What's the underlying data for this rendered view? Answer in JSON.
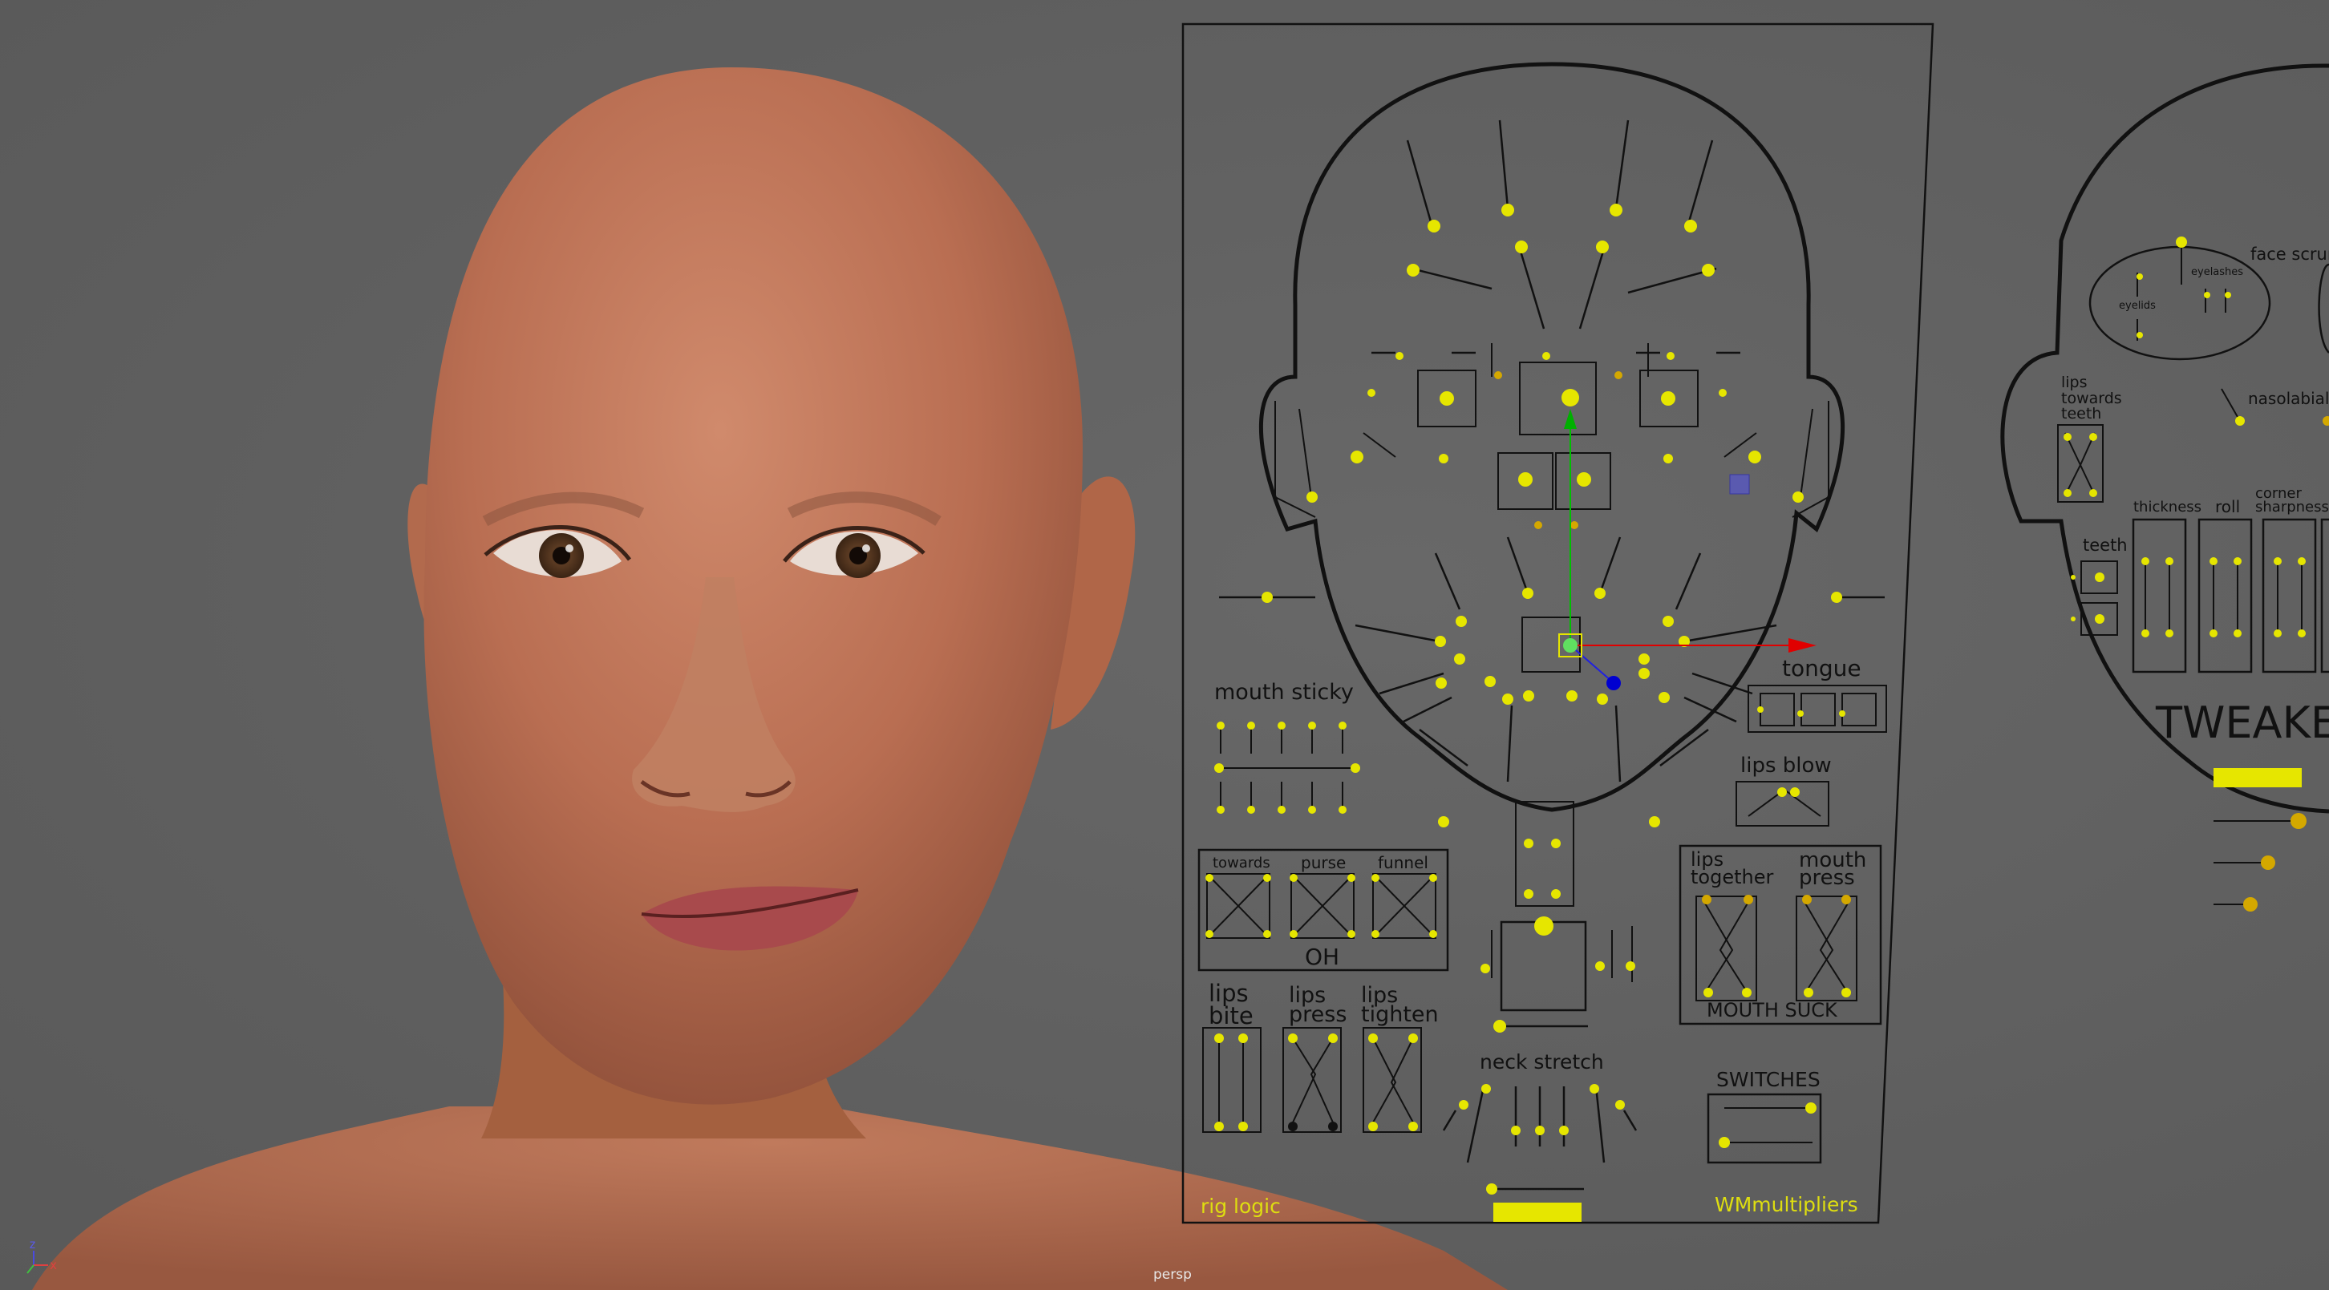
{
  "viewport": {
    "camera": "persp",
    "background": "#5f5f5f",
    "axis": {
      "x": "x",
      "z": "z"
    }
  },
  "rig_panel": {
    "labels": {
      "mouth_sticky": "mouth sticky",
      "tongue": "tongue",
      "lips_blow": "lips blow",
      "towards": "towards",
      "purse": "purse",
      "funnel": "funnel",
      "oh": "OH",
      "lips_together_1": "lips",
      "lips_together_2": "together",
      "mouth_press_1": "mouth",
      "mouth_press_2": "press",
      "mouth_suck": "MOUTH SUCK",
      "lips_bite_1": "lips",
      "lips_bite_2": "bite",
      "lips_press_1": "lips",
      "lips_press_2": "press",
      "lips_tighten_1": "lips",
      "lips_tighten_2": "tighten",
      "neck_stretch": "neck stretch",
      "switches": "SWITCHES",
      "rig_logic": "rig logic",
      "wm_multipliers": "WMmultipliers"
    },
    "colors": {
      "control_yellow": "#e6e600",
      "control_orange": "#d4a800",
      "outline": "#111111",
      "manip_x": "#e00000",
      "manip_y": "#00c000",
      "manip_z": "#0000e0"
    }
  },
  "tweaker_panel": {
    "labels": {
      "face_scrunch": "face scrun",
      "eyelashes": "eyelashes",
      "eyelids": "eyelids",
      "lips_towards_teeth_1": "lips",
      "lips_towards_teeth_2": "towards",
      "lips_towards_teeth_3": "teeth",
      "nasolabial": "nasolabial",
      "thickness": "thickness",
      "roll": "roll",
      "corner_1": "corner",
      "corner_2": "sharpness",
      "teeth": "teeth",
      "tweaker": "TWEAKER"
    }
  }
}
